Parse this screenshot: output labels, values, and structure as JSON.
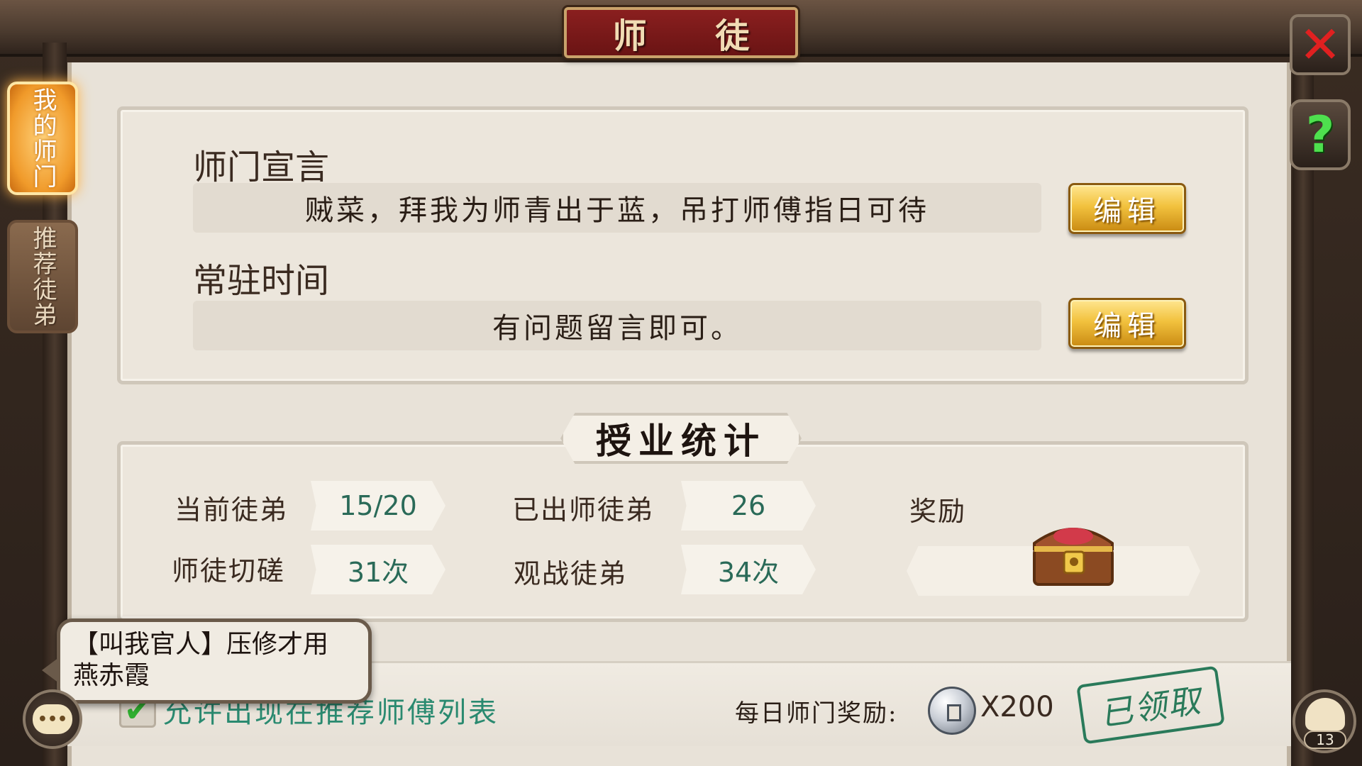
{
  "window": {
    "title": "师 徒"
  },
  "side_tabs": [
    {
      "label": "我的师门",
      "active": true
    },
    {
      "label": "推荐徒弟",
      "active": false
    }
  ],
  "header_buttons": {
    "close_icon": "close-icon",
    "help_icon": "help-icon"
  },
  "declaration": {
    "title": "师门宣言",
    "text": "贼菜，拜我为师青出于蓝，吊打师傅指日可待",
    "edit_label": "编辑"
  },
  "online_time": {
    "title": "常驻时间",
    "text": "有问题留言即可。",
    "edit_label": "编辑"
  },
  "stats": {
    "banner": "授业统计",
    "current_disciples_label": "当前徒弟",
    "current_disciples_value": "15/20",
    "graduated_label": "已出师徒弟",
    "graduated_value": "26",
    "sparring_label": "师徒切磋",
    "sparring_value": "31次",
    "spectate_label": "观战徒弟",
    "spectate_value": "34次",
    "reward_label": "奖励",
    "reward_icon": "treasure-chest-icon"
  },
  "bottom": {
    "checkbox_checked": true,
    "checkbox_label": "允许出现在推荐师傅列表",
    "daily_reward_label": "每日师门奖励:",
    "daily_reward_count": "X200",
    "daily_reward_icon": "silver-coin-icon",
    "claimed_label": "已领取"
  },
  "chat": {
    "line1": "【叫我官人】压修才用",
    "line2": "燕赤霞",
    "chat_icon": "chat-icon"
  },
  "friends": {
    "count": "13",
    "icon": "friends-icon"
  },
  "colors": {
    "accent_gold": "#f2c23e",
    "title_red": "#8a1f1f",
    "value_teal": "#2a6a58"
  }
}
